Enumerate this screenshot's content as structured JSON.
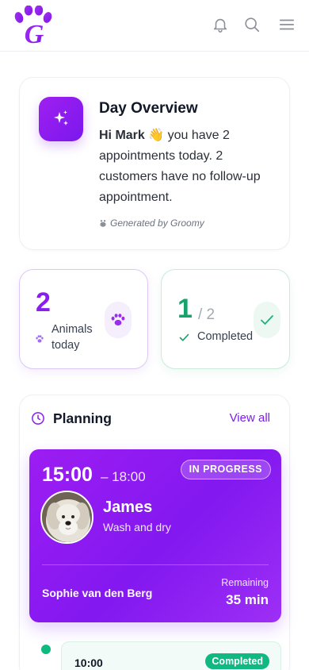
{
  "header": {
    "logo_icon": "groomy-paw-logo",
    "icons": [
      "bell-icon",
      "search-icon",
      "menu-icon"
    ]
  },
  "overview": {
    "title": "Day Overview",
    "greeting_name": "Hi Mark",
    "wave_emoji": "👋",
    "message": " you have 2 appointments today. 2 customers have no follow-up appointment.",
    "generated_by": "Generated by Groomy",
    "icon": "sparkles-icon",
    "accent_color": "#8f1cf0"
  },
  "stats": {
    "animals": {
      "value": "2",
      "label": "Animals today",
      "icon": "paw-icon"
    },
    "completed": {
      "value": "1",
      "total": "/ 2",
      "label": "Completed",
      "icon": "check-icon"
    }
  },
  "planning": {
    "title": "Planning",
    "view_all": "View all",
    "current": {
      "start": "15:00",
      "end": "– 18:00",
      "status": "IN PROGRESS",
      "pet_name": "James",
      "service": "Wash and dry",
      "owner": "Sophie van den Berg",
      "remaining_label": "Remaining",
      "remaining_value": "35 min"
    },
    "next": {
      "time": "10:00",
      "status": "Completed",
      "status_color": "#10b981"
    }
  }
}
